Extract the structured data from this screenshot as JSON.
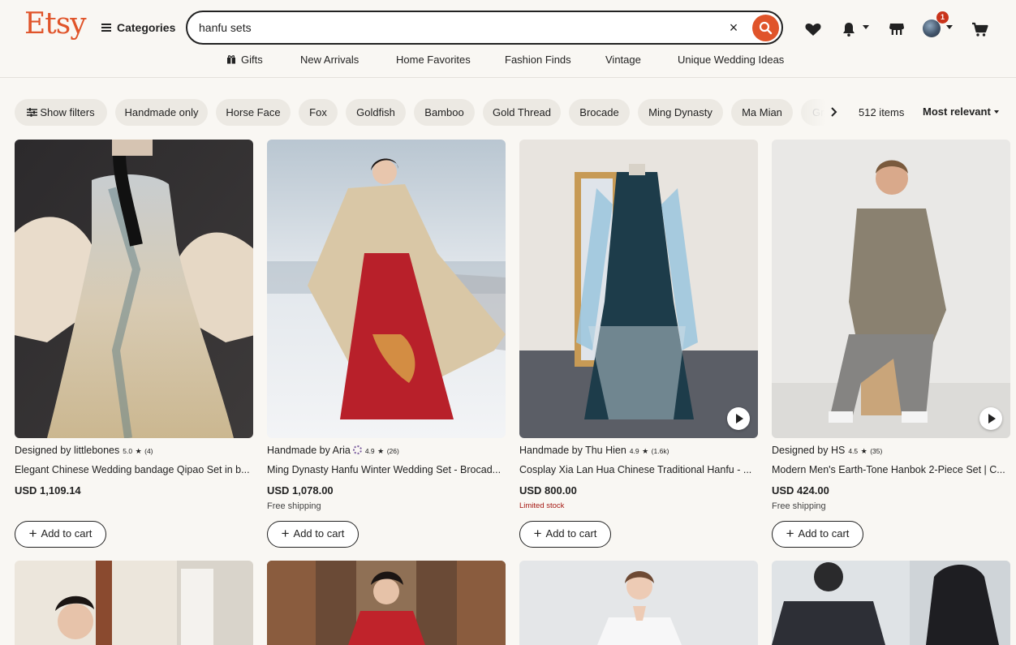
{
  "header": {
    "logo": "Etsy",
    "categories_label": "Categories",
    "search_value": "hanfu sets",
    "clear_label": "×",
    "cart_badge": "1",
    "nav": [
      "Gifts",
      "New Arrivals",
      "Home Favorites",
      "Fashion Finds",
      "Vintage",
      "Unique Wedding Ideas"
    ]
  },
  "filters": {
    "show_filters": "Show filters",
    "chips": [
      "Handmade only",
      "Horse Face",
      "Fox",
      "Goldfish",
      "Bamboo",
      "Gold Thread",
      "Brocade",
      "Ming Dynasty",
      "Ma Mian",
      "Gr"
    ],
    "item_count": "512 items",
    "sort_label": "Most relevant"
  },
  "products": [
    {
      "seller": "Designed by littlebones",
      "rating": "5.0",
      "reviews": "(4)",
      "title": "Elegant Chinese Wedding bandage Qipao Set in b...",
      "price": "USD 1,109.14",
      "note": "",
      "cart_label": "Add to cart"
    },
    {
      "seller": "Handmade by Aria",
      "rating": "4.9",
      "reviews": "(26)",
      "title": "Ming Dynasty Hanfu Winter Wedding Set - Brocad...",
      "price": "USD 1,078.00",
      "note": "Free shipping",
      "cart_label": "Add to cart"
    },
    {
      "seller": "Handmade by Thu Hien",
      "rating": "4.9",
      "reviews": "(1.6k)",
      "title": "Cosplay Xia Lan Hua Chinese Traditional Hanfu - ...",
      "price": "USD 800.00",
      "note": "Limited stock",
      "cart_label": "Add to cart"
    },
    {
      "seller": "Designed by HS",
      "rating": "4.5",
      "reviews": "(35)",
      "title": "Modern Men's Earth-Tone Hanbok 2-Piece Set | C...",
      "price": "USD 424.00",
      "note": "Free shipping",
      "cart_label": "Add to cart"
    }
  ],
  "colors": {
    "brand": "#e0542a",
    "badge": "#c9331a",
    "limited_stock": "#a61a14"
  },
  "icons": [
    "menu-icon",
    "close-icon",
    "search-icon",
    "heart-icon",
    "bell-icon",
    "shop-icon",
    "cart-icon",
    "gift-icon",
    "filter-icon",
    "chevron-right-icon",
    "play-icon",
    "star-icon",
    "plus-icon"
  ]
}
